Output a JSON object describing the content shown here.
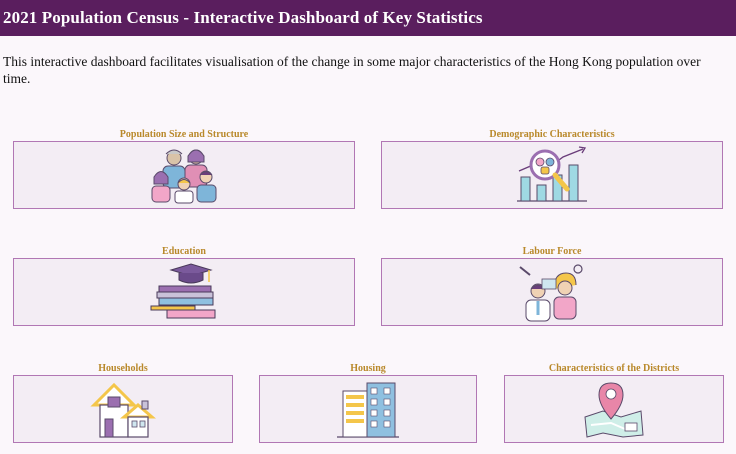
{
  "header": {
    "title": "2021 Population Census - Interactive Dashboard of Key Statistics"
  },
  "intro": {
    "text": "This interactive dashboard facilitates visualisation of the change in some major characteristics of the Hong Kong population over time."
  },
  "cards": [
    {
      "id": "population",
      "title": "Population Size and Structure",
      "icon": "family-icon"
    },
    {
      "id": "demographic",
      "title": "Demographic Characteristics",
      "icon": "magnifier-chart-icon"
    },
    {
      "id": "education",
      "title": "Education",
      "icon": "graduation-books-icon"
    },
    {
      "id": "labour",
      "title": "Labour Force",
      "icon": "workers-icon"
    },
    {
      "id": "households",
      "title": "Households",
      "icon": "houses-icon"
    },
    {
      "id": "housing",
      "title": "Housing",
      "icon": "building-icon"
    },
    {
      "id": "districts",
      "title": "Characteristics of the Districts",
      "icon": "map-pin-icon"
    }
  ],
  "colors": {
    "header_bg": "#5a1e5e",
    "card_border": "#b177b4",
    "card_bg": "#f3edf4",
    "title_color": "#b9892b"
  }
}
